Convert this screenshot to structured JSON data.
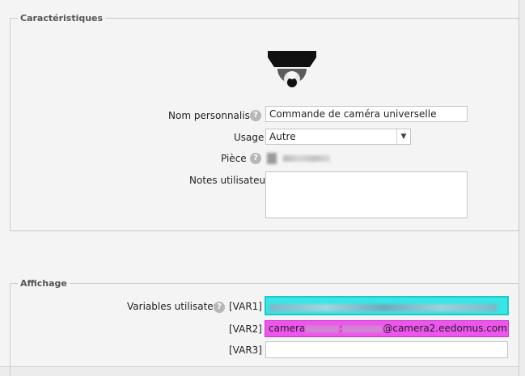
{
  "section_characteristics": {
    "legend": "Caractéristiques",
    "custom_name_label": "Nom personnalisé",
    "custom_name_value": "Commande de caméra universelle",
    "usage_label": "Usage",
    "usage_value": "Autre",
    "room_label": "Pièce",
    "notes_label": "Notes utilisateur",
    "notes_value": ""
  },
  "section_display": {
    "legend": "Affichage",
    "user_variables_label": "Variables utilisateur",
    "var1_label": "[VAR1]",
    "var2_label": "[VAR2]",
    "var2_prefix": "camera",
    "var2_sep": ":",
    "var2_suffix": "@camera2.eedomus.com",
    "var3_label": "[VAR3]",
    "var3_value": ""
  },
  "icons": {
    "help": "help-icon",
    "device": "dome-camera-icon",
    "dropdown": "chevron-down-icon"
  },
  "colors": {
    "var1_bg": "#37e6e6",
    "var2_bg": "#ee55ee"
  }
}
